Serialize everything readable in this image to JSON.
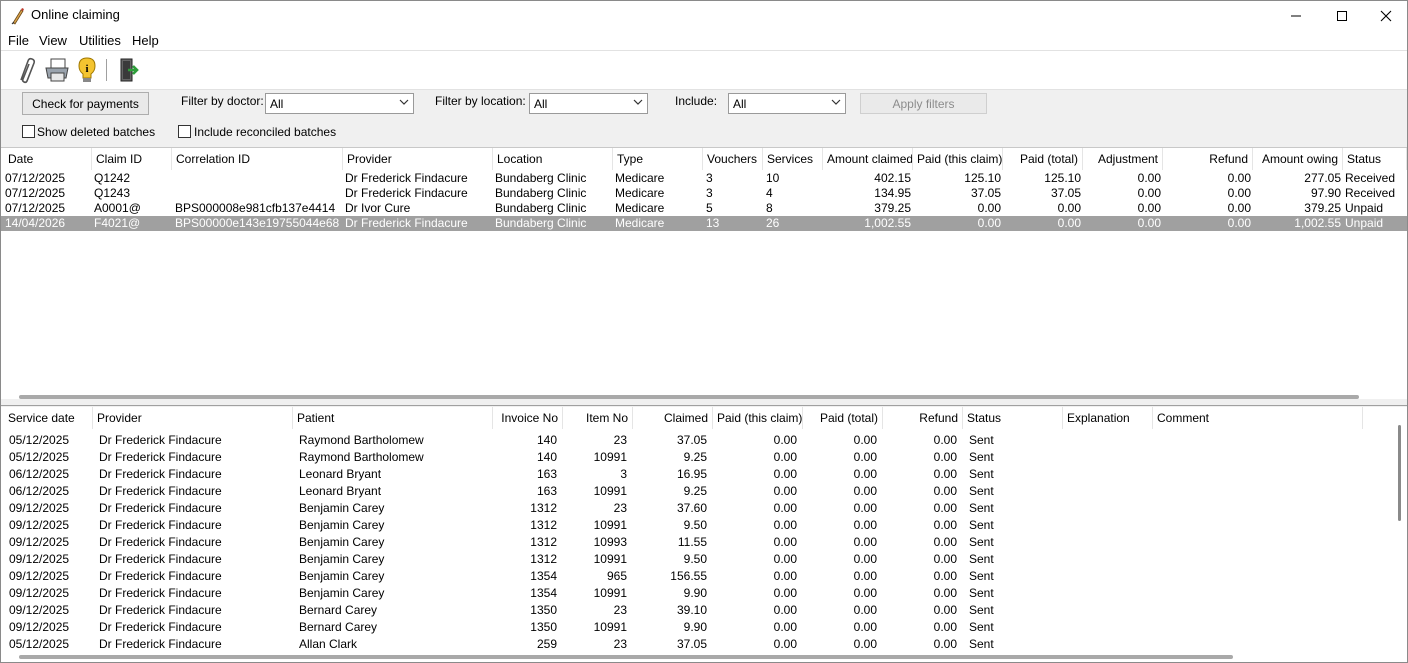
{
  "window": {
    "title": "Online claiming"
  },
  "menu": {
    "file": "File",
    "view": "View",
    "utilities": "Utilities",
    "help": "Help"
  },
  "toolbar": {
    "icons": [
      "paperclip-icon",
      "printer-icon",
      "info-icon",
      "exit-icon"
    ]
  },
  "filters": {
    "check_payments": "Check for payments",
    "doctor_label": "Filter by doctor:",
    "doctor_value": "All",
    "location_label": "Filter by location:",
    "location_value": "All",
    "include_label": "Include:",
    "include_value": "All",
    "apply": "Apply filters",
    "show_deleted": "Show deleted batches",
    "include_reconciled": "Include reconciled batches"
  },
  "batches": {
    "columns": [
      "Date",
      "Claim ID",
      "Correlation ID",
      "Provider",
      "Location",
      "Type",
      "Vouchers",
      "Services",
      "Amount claimed",
      "Paid (this claim)",
      "Paid (total)",
      "Adjustment",
      "Refund",
      "Amount owing",
      "Status"
    ],
    "rows": [
      [
        "07/12/2025",
        "Q1242",
        "",
        "Dr Frederick Findacure",
        "Bundaberg Clinic",
        "Medicare",
        "3",
        "10",
        "402.15",
        "125.10",
        "125.10",
        "0.00",
        "0.00",
        "277.05",
        "Received"
      ],
      [
        "07/12/2025",
        "Q1243",
        "",
        "Dr Frederick Findacure",
        "Bundaberg Clinic",
        "Medicare",
        "3",
        "4",
        "134.95",
        "37.05",
        "37.05",
        "0.00",
        "0.00",
        "97.90",
        "Received"
      ],
      [
        "07/12/2025",
        "A0001@",
        "BPS000008e981cfb137e4414",
        "Dr Ivor Cure",
        "Bundaberg Clinic",
        "Medicare",
        "5",
        "8",
        "379.25",
        "0.00",
        "0.00",
        "0.00",
        "0.00",
        "379.25",
        "Unpaid"
      ],
      [
        "14/04/2026",
        "F4021@",
        "BPS00000e143e19755044e68",
        "Dr Frederick Findacure",
        "Bundaberg Clinic",
        "Medicare",
        "13",
        "26",
        "1,002.55",
        "0.00",
        "0.00",
        "0.00",
        "0.00",
        "1,002.55",
        "Unpaid"
      ]
    ],
    "selected_index": 3
  },
  "services": {
    "columns": [
      "Service date",
      "Provider",
      "Patient",
      "Invoice No",
      "Item No",
      "Claimed",
      "Paid (this claim)",
      "Paid (total)",
      "Refund",
      "Status",
      "Explanation",
      "Comment"
    ],
    "rows": [
      [
        "05/12/2025",
        "Dr Frederick Findacure",
        "Raymond Bartholomew",
        "140",
        "23",
        "37.05",
        "0.00",
        "0.00",
        "0.00",
        "Sent",
        "",
        ""
      ],
      [
        "05/12/2025",
        "Dr Frederick Findacure",
        "Raymond Bartholomew",
        "140",
        "10991",
        "9.25",
        "0.00",
        "0.00",
        "0.00",
        "Sent",
        "",
        ""
      ],
      [
        "06/12/2025",
        "Dr Frederick Findacure",
        "Leonard Bryant",
        "163",
        "3",
        "16.95",
        "0.00",
        "0.00",
        "0.00",
        "Sent",
        "",
        ""
      ],
      [
        "06/12/2025",
        "Dr Frederick Findacure",
        "Leonard Bryant",
        "163",
        "10991",
        "9.25",
        "0.00",
        "0.00",
        "0.00",
        "Sent",
        "",
        ""
      ],
      [
        "09/12/2025",
        "Dr Frederick Findacure",
        "Benjamin Carey",
        "1312",
        "23",
        "37.60",
        "0.00",
        "0.00",
        "0.00",
        "Sent",
        "",
        ""
      ],
      [
        "09/12/2025",
        "Dr Frederick Findacure",
        "Benjamin Carey",
        "1312",
        "10991",
        "9.50",
        "0.00",
        "0.00",
        "0.00",
        "Sent",
        "",
        ""
      ],
      [
        "09/12/2025",
        "Dr Frederick Findacure",
        "Benjamin Carey",
        "1312",
        "10993",
        "11.55",
        "0.00",
        "0.00",
        "0.00",
        "Sent",
        "",
        ""
      ],
      [
        "09/12/2025",
        "Dr Frederick Findacure",
        "Benjamin Carey",
        "1312",
        "10991",
        "9.50",
        "0.00",
        "0.00",
        "0.00",
        "Sent",
        "",
        ""
      ],
      [
        "09/12/2025",
        "Dr Frederick Findacure",
        "Benjamin Carey",
        "1354",
        "965",
        "156.55",
        "0.00",
        "0.00",
        "0.00",
        "Sent",
        "",
        ""
      ],
      [
        "09/12/2025",
        "Dr Frederick Findacure",
        "Benjamin Carey",
        "1354",
        "10991",
        "9.90",
        "0.00",
        "0.00",
        "0.00",
        "Sent",
        "",
        ""
      ],
      [
        "09/12/2025",
        "Dr Frederick Findacure",
        "Bernard Carey",
        "1350",
        "23",
        "39.10",
        "0.00",
        "0.00",
        "0.00",
        "Sent",
        "",
        ""
      ],
      [
        "09/12/2025",
        "Dr Frederick Findacure",
        "Bernard Carey",
        "1350",
        "10991",
        "9.90",
        "0.00",
        "0.00",
        "0.00",
        "Sent",
        "",
        ""
      ],
      [
        "05/12/2025",
        "Dr Frederick Findacure",
        "Allan Clark",
        "259",
        "23",
        "37.05",
        "0.00",
        "0.00",
        "0.00",
        "Sent",
        "",
        ""
      ]
    ]
  },
  "colors": {
    "selected_row": "#a0a0a0",
    "window_bg": "#f0f0f0"
  }
}
